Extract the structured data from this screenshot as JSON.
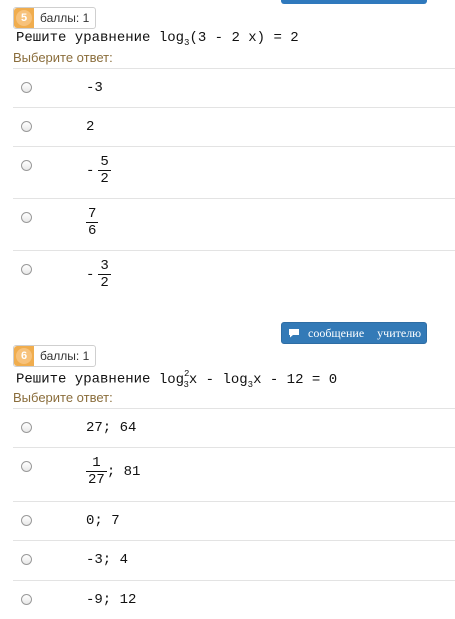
{
  "questions": [
    {
      "number": "5",
      "points_label": "баллы: 1",
      "text_prefix": "Решите уравнение ",
      "choose_label": "Выберите ответ:",
      "answers": [
        {
          "text": "-3"
        },
        {
          "text": "2"
        },
        {
          "sign": "-",
          "num": "5",
          "den": "2"
        },
        {
          "num": "7",
          "den": "6"
        },
        {
          "sign": "-",
          "num": "3",
          "den": "2"
        }
      ]
    },
    {
      "number": "6",
      "points_label": "баллы: 1",
      "text_prefix": "Решите уравнение ",
      "choose_label": "Выберите ответ:",
      "answers": [
        {
          "text": "27; 64"
        },
        {
          "num": "1",
          "den": "27",
          "suffix": "; 81"
        },
        {
          "text": "0; 7"
        },
        {
          "text": "-3; 4"
        },
        {
          "text": "-9; 12"
        }
      ]
    }
  ],
  "message_button": {
    "label": "сообщение учителю"
  },
  "colors": {
    "badge": "#f0ad4e",
    "button": "#337ab7",
    "choose_label": "#8a6d3b"
  }
}
